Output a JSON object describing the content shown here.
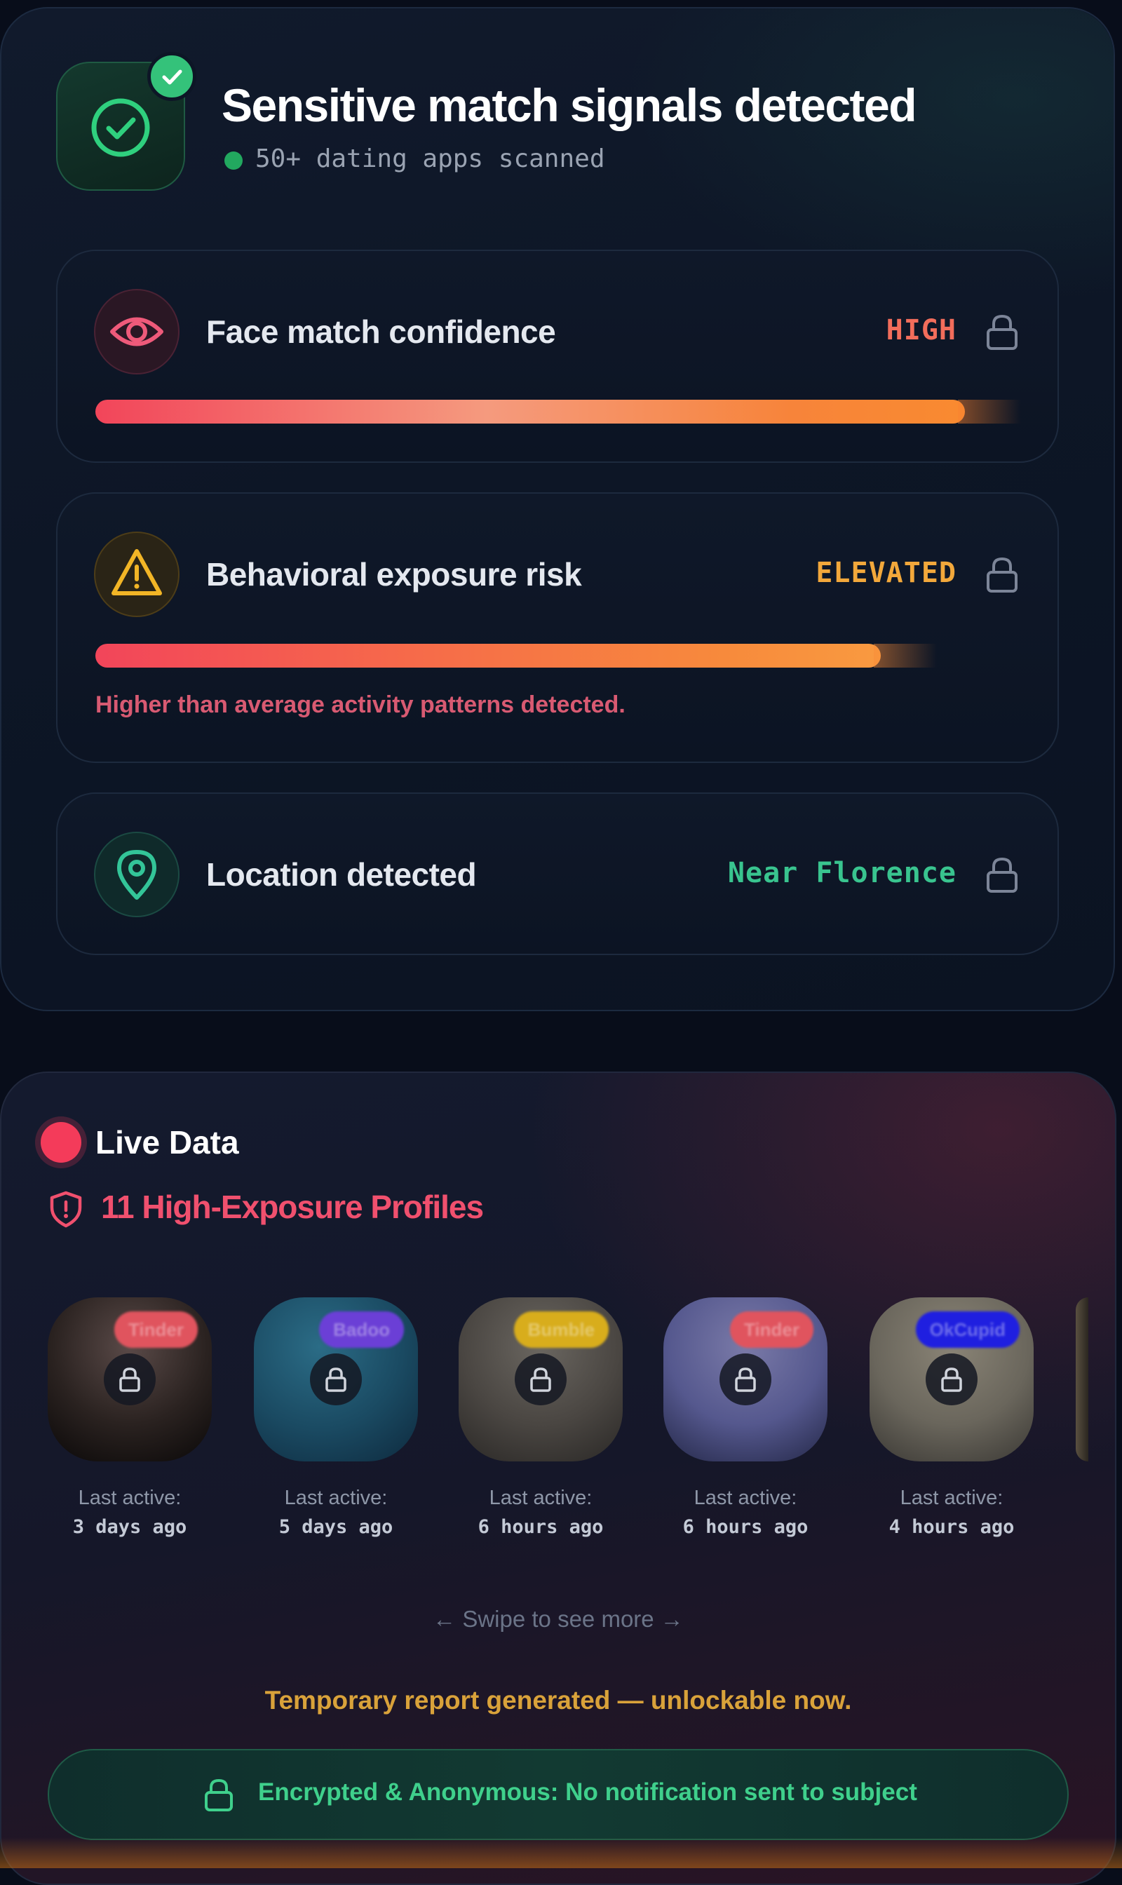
{
  "header": {
    "title": "Sensitive match signals detected",
    "subtitle": "50+ dating apps scanned"
  },
  "metrics": [
    {
      "label": "Face match confidence",
      "value": "HIGH",
      "value_color": "#f26d5b",
      "level": 0.95,
      "icon": "eye-icon"
    },
    {
      "label": "Behavioral exposure risk",
      "value": "ELEVATED",
      "value_color": "#f2a83b",
      "level": 0.85,
      "icon": "warning-icon",
      "note": "Higher than average activity patterns detected."
    },
    {
      "label": "Location detected",
      "value": "Near Florence",
      "value_color": "#39c48f",
      "icon": "location-pin-icon"
    }
  ],
  "live": {
    "label": "Live Data",
    "profiles_label": "11 High-Exposure Profiles",
    "accent": "#f43b5a"
  },
  "profiles": [
    {
      "app": "Tinder",
      "badge_color": "#e0545e",
      "last_active_label": "Last active:",
      "last_active": "3 days ago"
    },
    {
      "app": "Badoo",
      "badge_color": "#6b3fd6",
      "last_active_label": "Last active:",
      "last_active": "5 days ago"
    },
    {
      "app": "Bumble",
      "badge_color": "#d8ad1c",
      "last_active_label": "Last active:",
      "last_active": "6 hours ago"
    },
    {
      "app": "Tinder",
      "badge_color": "#e0545e",
      "last_active_label": "Last active:",
      "last_active": "6 hours ago"
    },
    {
      "app": "OkCupid",
      "badge_color": "#1f1fe0",
      "last_active_label": "Last active:",
      "last_active": "4 hours ago"
    }
  ],
  "footer": {
    "swipe_hint": "← Swipe to see more →",
    "temp_report": "Temporary report generated — unlockable now.",
    "encrypted": "Encrypted & Anonymous: No notification sent to subject"
  }
}
